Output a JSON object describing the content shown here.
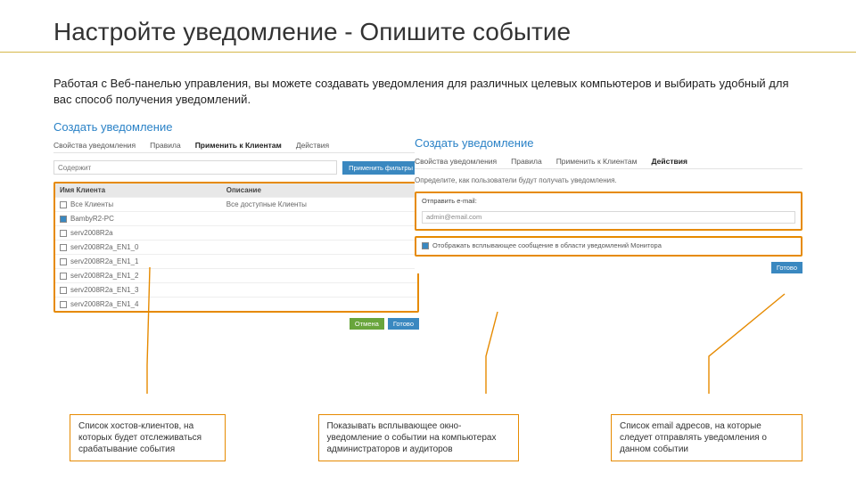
{
  "title": "Настройте уведомление - Опишите событие",
  "intro": "Работая с Веб-панелью управления, вы можете создавать уведомления для различных целевых компьютеров и выбирать удобный для вас способ получения уведомлений.",
  "left_panel": {
    "heading": "Создать уведомление",
    "tabs": [
      "Свойства уведомления",
      "Правила",
      "Применить к Клиентам",
      "Действия"
    ],
    "active_tab": 2,
    "filter_placeholder": "Содержит",
    "apply_filters": "Применить фильтры",
    "col_name": "Имя Клиента",
    "col_desc": "Описание",
    "rows": [
      {
        "checked": false,
        "name": "Все Клиенты",
        "desc": "Все доступные Клиенты"
      },
      {
        "checked": true,
        "name": "BambyR2-PC",
        "desc": ""
      },
      {
        "checked": false,
        "name": "serv2008R2a",
        "desc": ""
      },
      {
        "checked": false,
        "name": "serv2008R2a_EN1_0",
        "desc": ""
      },
      {
        "checked": false,
        "name": "serv2008R2a_EN1_1",
        "desc": ""
      },
      {
        "checked": false,
        "name": "serv2008R2a_EN1_2",
        "desc": ""
      },
      {
        "checked": false,
        "name": "serv2008R2a_EN1_3",
        "desc": ""
      },
      {
        "checked": false,
        "name": "serv2008R2a_EN1_4",
        "desc": ""
      }
    ],
    "btn_cancel": "Отмена",
    "btn_apply": "Готово"
  },
  "right_panel": {
    "heading": "Создать уведомление",
    "tabs": [
      "Свойства уведомления",
      "Правила",
      "Применить к Клиентам",
      "Действия"
    ],
    "active_tab": 3,
    "instruction": "Определите, как пользователи будут получать уведомления.",
    "email_label": "Отправить e-mail:",
    "email_value": "admin@email.com",
    "popup_label": "Отображать всплывающее сообщение в области уведомлений Монитора",
    "btn_done": "Готово"
  },
  "callouts": {
    "c1": "Список хостов-клиентов, на которых будет отслеживаться срабатывание события",
    "c2": "Показывать всплывающее окно-уведомление о событии на компьютерах администраторов и аудиторов",
    "c3": "Список email адресов, на которые следует отправлять уведомления о данном событии"
  }
}
